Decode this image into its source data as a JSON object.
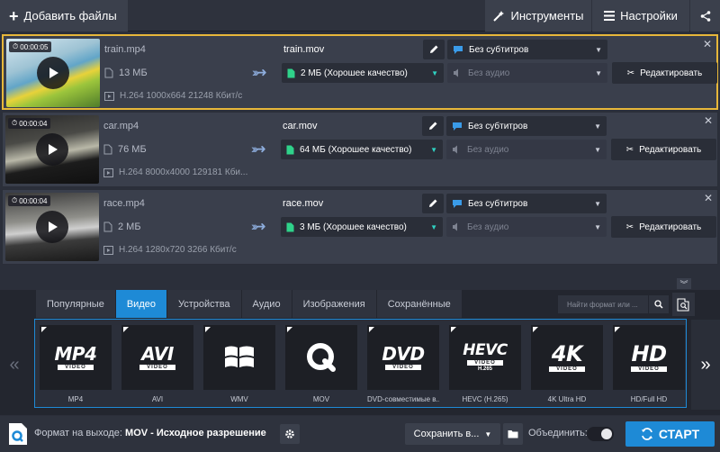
{
  "toolbar": {
    "add_files": "Добавить файлы",
    "tools": "Инструменты",
    "settings": "Настройки"
  },
  "files": [
    {
      "duration": "00:00:05",
      "source_name": "train.mp4",
      "source_size": "13 МБ",
      "codec": "H.264 1000x664 21248 Кбит/с",
      "output_name": "train.mov",
      "quality": "2 МБ (Хорошее качество)",
      "subtitles": "Без субтитров",
      "audio": "Без аудио",
      "edit_label": "Редактировать",
      "selected": true
    },
    {
      "duration": "00:00:04",
      "source_name": "car.mp4",
      "source_size": "76 МБ",
      "codec": "H.264 8000x4000 129181 Кби...",
      "output_name": "car.mov",
      "quality": "64 МБ (Хорошее качество)",
      "subtitles": "Без субтитров",
      "audio": "Без аудио",
      "edit_label": "Редактировать",
      "selected": false
    },
    {
      "duration": "00:00:04",
      "source_name": "race.mp4",
      "source_size": "2 МБ",
      "codec": "H.264 1280x720 3266 Кбит/с",
      "output_name": "race.mov",
      "quality": "3 МБ (Хорошее качество)",
      "subtitles": "Без субтитров",
      "audio": "Без аудио",
      "edit_label": "Редактировать",
      "selected": false
    }
  ],
  "tabs": [
    "Популярные",
    "Видео",
    "Устройства",
    "Аудио",
    "Изображения",
    "Сохранённые"
  ],
  "active_tab": "Видео",
  "search": {
    "placeholder": "Найти формат или ..."
  },
  "formats": [
    {
      "big": "MP4",
      "sub": "VIDEO",
      "label": "MP4"
    },
    {
      "big": "AVI",
      "sub": "VIDEO",
      "label": "AVI"
    },
    {
      "big": "",
      "sub": "",
      "label": "WMV"
    },
    {
      "big": "",
      "sub": "",
      "label": "MOV"
    },
    {
      "big": "DVD",
      "sub": "VIDEO",
      "label": "DVD-совместимые в..."
    },
    {
      "big": "HEVC",
      "sub": "VIDEO",
      "sub2": "H.265",
      "label": "HEVC (H.265)"
    },
    {
      "big": "4K",
      "sub": "VIDEO",
      "label": "4K Ultra HD"
    },
    {
      "big": "HD",
      "sub": "VIDEO",
      "label": "HD/Full HD"
    }
  ],
  "footer": {
    "output_prefix": "Формат на выходе: ",
    "output_value": "MOV - Исходное разрешение",
    "save_label": "Сохранить в...",
    "merge_label": "Объединить:",
    "start_label": "СТАРТ"
  },
  "colors": {
    "accent": "#1e8ad6",
    "selected_border": "#e7b73a",
    "panel": "#3a3f4c",
    "background": "#2b2f3a"
  }
}
